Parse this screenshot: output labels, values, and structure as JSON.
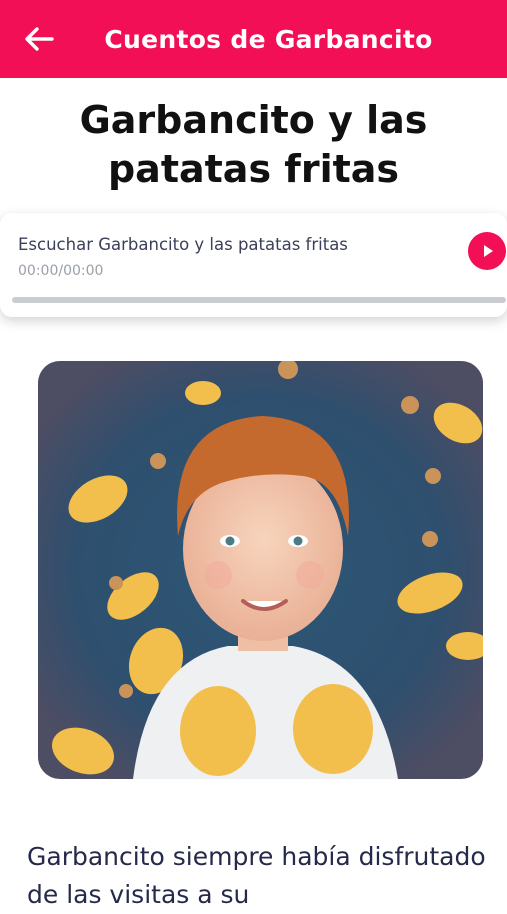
{
  "appbar": {
    "title": "Cuentos de Garbancito",
    "back_icon": "arrow-left-icon"
  },
  "story": {
    "title": "Garbancito y las patatas fritas"
  },
  "player": {
    "label": "Escuchar Garbancito y las patatas fritas",
    "time": "00:00/00:00",
    "play_icon": "play-icon",
    "progress": 0
  },
  "colors": {
    "accent": "#f20f55",
    "track": "#c9ccd1"
  },
  "content": {
    "paragraph": "Garbancito siempre había disfrutado de las visitas a su"
  }
}
